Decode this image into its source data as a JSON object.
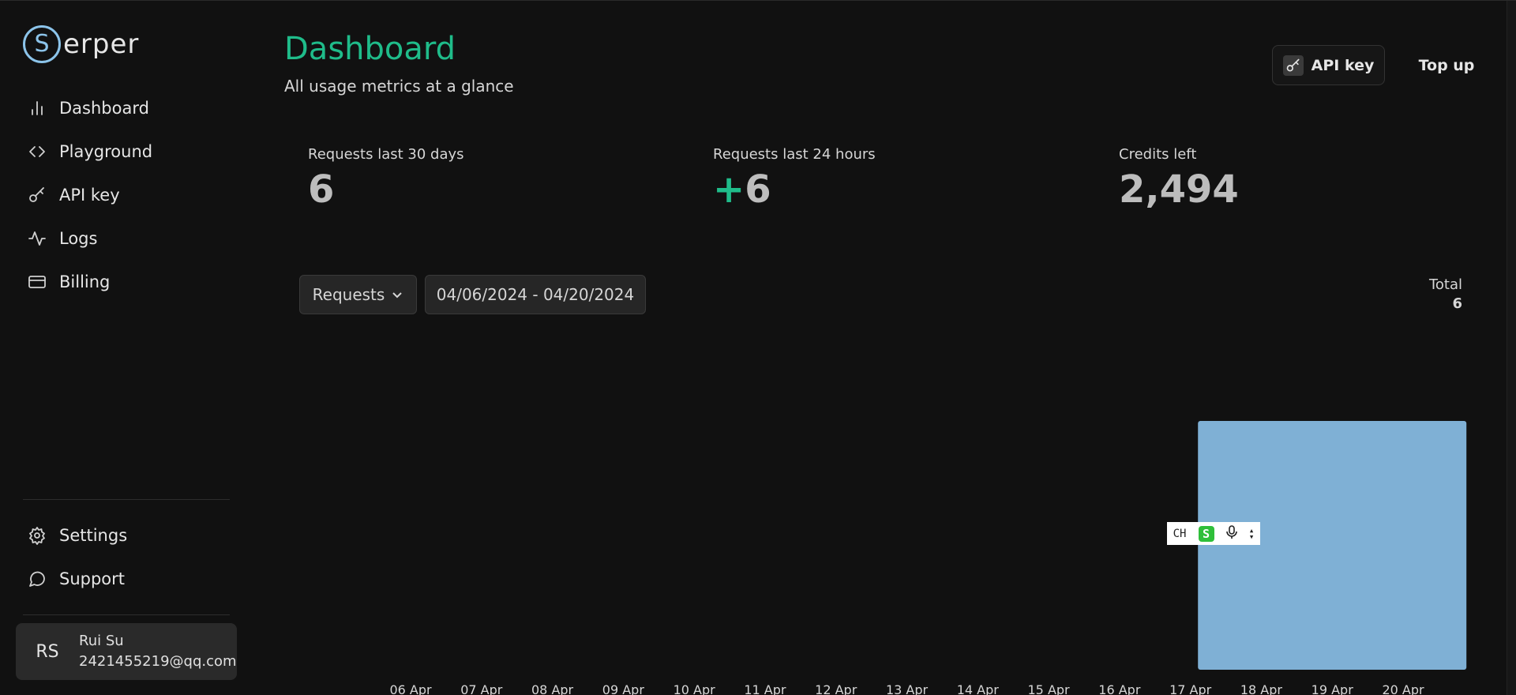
{
  "brand": {
    "logo_letter": "S",
    "logo_rest": "erper"
  },
  "sidebar": {
    "nav_items": [
      {
        "label": "Dashboard",
        "icon": "bar-chart-icon"
      },
      {
        "label": "Playground",
        "icon": "code-icon"
      },
      {
        "label": "API key",
        "icon": "key-icon"
      },
      {
        "label": "Logs",
        "icon": "activity-icon"
      },
      {
        "label": "Billing",
        "icon": "credit-card-icon"
      }
    ],
    "bottom_items": [
      {
        "label": "Settings",
        "icon": "gear-icon"
      },
      {
        "label": "Support",
        "icon": "message-circle-icon"
      }
    ],
    "user": {
      "initials": "RS",
      "name": "Rui Su",
      "email": "2421455219@qq.com"
    }
  },
  "header": {
    "title": "Dashboard",
    "subtitle": "All usage metrics at a glance",
    "api_key_button": "API key",
    "top_up_button": "Top up"
  },
  "stats": [
    {
      "label": "Requests last 30 days",
      "value": "6"
    },
    {
      "label": "Requests last 24 hours",
      "prefix": "+",
      "value": "6"
    },
    {
      "label": "Credits left",
      "value": "2,494"
    }
  ],
  "filters": {
    "metric_select": "Requests",
    "date_range": "04/06/2024 - 04/20/2024"
  },
  "total": {
    "label": "Total",
    "value": "6"
  },
  "ime_toolbar": {
    "text": "CH",
    "s_glyph": "S"
  },
  "chart_data": {
    "type": "bar",
    "categories": [
      "06 Apr",
      "07 Apr",
      "08 Apr",
      "09 Apr",
      "10 Apr",
      "11 Apr",
      "12 Apr",
      "13 Apr",
      "14 Apr",
      "15 Apr",
      "16 Apr",
      "17 Apr",
      "18 Apr",
      "19 Apr",
      "20 Apr"
    ],
    "values": [
      0,
      0,
      0,
      0,
      0,
      0,
      0,
      0,
      0,
      0,
      0,
      0,
      0,
      6,
      0
    ],
    "ylim": [
      0,
      8
    ],
    "bar_color": "#7fb0d5",
    "grid": false,
    "title": "",
    "xlabel": "",
    "ylabel": ""
  },
  "colors": {
    "accent": "#1fbc8a",
    "background": "#111111",
    "logo": "#8cc4ea"
  }
}
